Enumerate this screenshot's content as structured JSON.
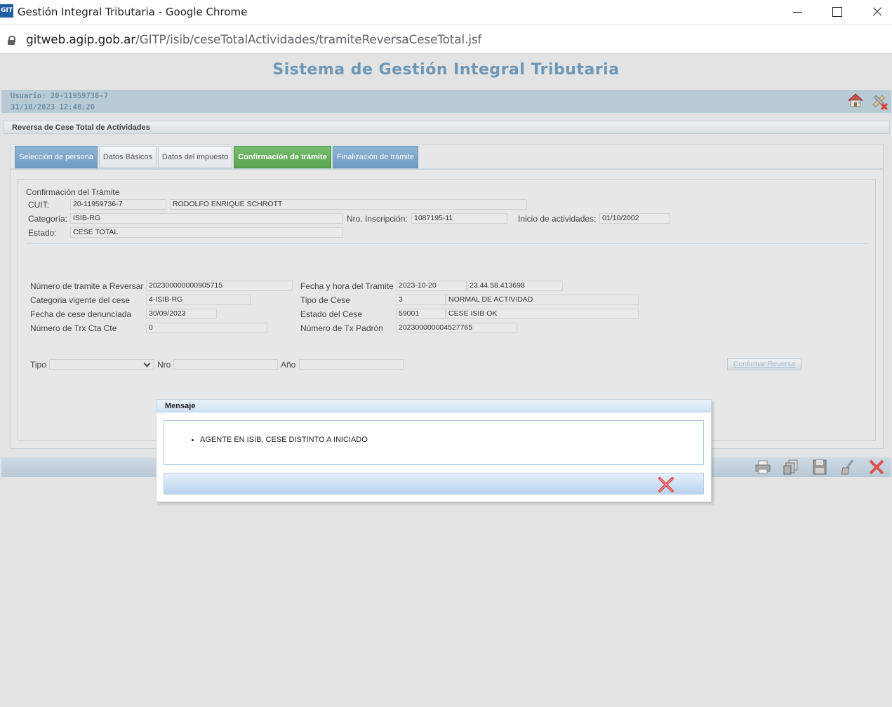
{
  "window": {
    "title": "Gestión Integral Tributaria - Google Chrome",
    "app_icon_text": "GIT"
  },
  "address": {
    "host": "gitweb.agip.gob.ar",
    "path": "/GITP/isib/ceseTotalActividades/tramiteReversaCeseTotal.jsf"
  },
  "header": {
    "system_title": "Sistema de Gestión Integral Tributaria",
    "user_line": "Usuario: 20-11959736-7",
    "datetime_line": "31/10/2023 12:48:20"
  },
  "section": {
    "title": "Reversa de Cese Total de Actividades"
  },
  "tabs": [
    {
      "label": "Selección de persona",
      "state": "done"
    },
    {
      "label": "Datos Básicos",
      "state": "normal"
    },
    {
      "label": "Datos del impuesto",
      "state": "normal"
    },
    {
      "label": "Confirmación de trámite",
      "state": "active"
    },
    {
      "label": "Finalización de trámite",
      "state": "done"
    }
  ],
  "confirm": {
    "heading": "Confirmación del Trámite",
    "cuit_label": "CUIT:",
    "cuit": "20-11959736-7",
    "name": "RODOLFO ENRIQUE SCHROTT",
    "categoria_label": "Categoría:",
    "categoria": "ISIB-RG",
    "nro_inscripcion_label": "Nro. Inscripción:",
    "nro_inscripcion": "1087195-11",
    "inicio_label": "Inicio de actividades:",
    "inicio": "01/10/2002",
    "estado_label": "Estado:",
    "estado": "CESE TOTAL"
  },
  "tramite": {
    "numero_label": "Número de tramite a Reversar",
    "numero": "202300000000905715",
    "categoria_vigente_label": "Categoria vigente del cese",
    "categoria_vigente": "4-ISIB-RG",
    "fecha_cese_label": "Fecha de cese denunciada",
    "fecha_cese": "30/09/2023",
    "numero_trx_label": "Número de Trx Cta Cte",
    "numero_trx": "0",
    "fecha_hora_label": "Fecha y hora del Tramite",
    "fecha": "2023-10-20",
    "hora": "23.44.58.413698",
    "tipo_cese_label": "Tipo de Cese",
    "tipo_cese_code": "3",
    "tipo_cese": "NORMAL DE ACTIVIDAD",
    "estado_cese_label": "Estado del Cese",
    "estado_cese_code": "59001",
    "estado_cese": "CESE ISIB OK",
    "numero_tx_padron_label": "Número de Tx Padrón",
    "numero_tx_padron": "202300000004527765"
  },
  "form": {
    "tipo_label": "Tipo",
    "tipo_value": "",
    "nro_label": "Nro",
    "nro_value": "",
    "anio_label": "Año",
    "anio_value": "",
    "confirm_button": "Confirmar Reversa"
  },
  "modal": {
    "title": "Mensaje",
    "message": "AGENTE EN ISIB, CESE DISTINTO A INICIADO"
  }
}
